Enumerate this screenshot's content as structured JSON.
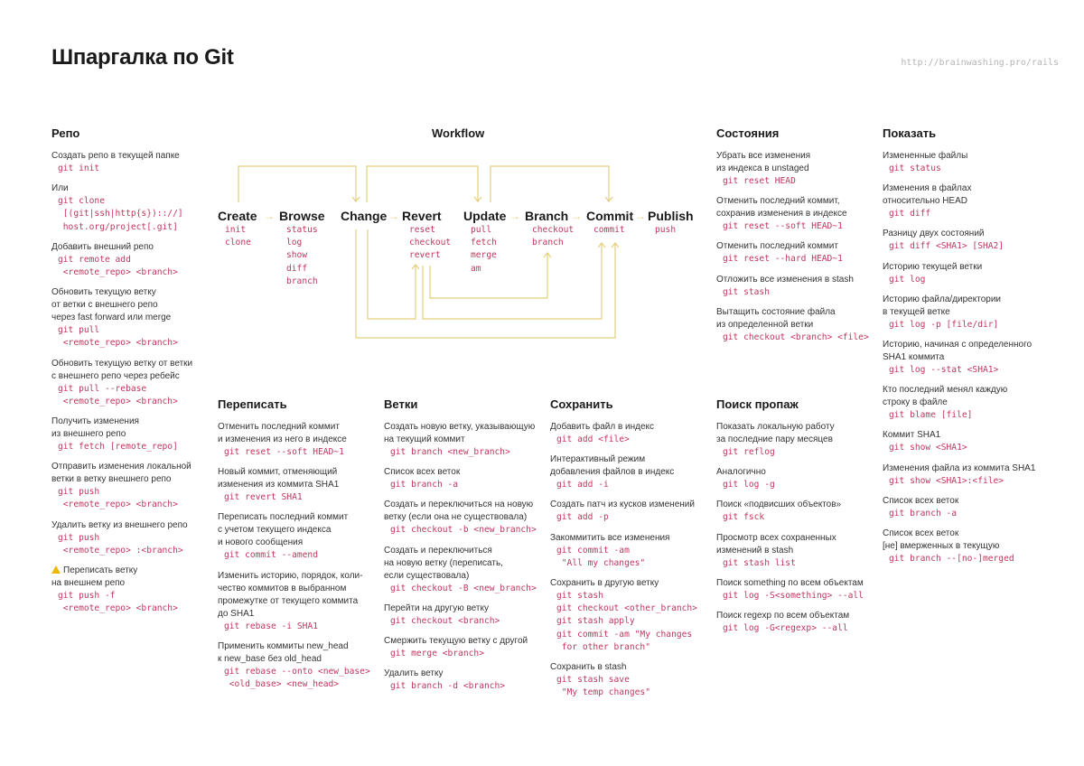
{
  "header": {
    "title": "Шпаргалка по Git",
    "url": "http://brainwashing.pro/rails"
  },
  "workflow": {
    "title": "Workflow",
    "arrow_color": "#e3cf7b",
    "stages": [
      {
        "name": "Create",
        "cmds": [
          "init",
          "clone"
        ]
      },
      {
        "name": "Browse",
        "cmds": [
          "status",
          "log",
          "show",
          "diff",
          "branch"
        ]
      },
      {
        "name": "Change",
        "cmds": []
      },
      {
        "name": "Revert",
        "cmds": [
          "reset",
          "checkout",
          "revert"
        ]
      },
      {
        "name": "Update",
        "cmds": [
          "pull",
          "fetch",
          "merge",
          "am"
        ]
      },
      {
        "name": "Branch",
        "cmds": [
          "checkout",
          "branch"
        ]
      },
      {
        "name": "Commit",
        "cmds": [
          "commit"
        ]
      },
      {
        "name": "Publish",
        "cmds": [
          "push"
        ]
      }
    ],
    "arrow_glyph": "→"
  },
  "sections": {
    "repo": {
      "title": "Репо",
      "entries": [
        {
          "desc": "Создать репо в текущей папке",
          "code": "git init"
        },
        {
          "desc": "Или",
          "code": "git clone\n [(git|ssh|http{s}):://]\n host.org/project[.git]"
        },
        {
          "desc": "Добавить внешний репо",
          "code": "git remote add\n <remote_repo> <branch>"
        },
        {
          "desc": "Обновить текущую ветку\nот ветки с внешнего репо\nчерез fast forward или merge",
          "code": "git pull\n <remote_repo> <branch>"
        },
        {
          "desc": "Обновить текущую ветку от ветки\nс внешнего репо через ребейс",
          "code": "git pull --rebase\n <remote_repo> <branch>"
        },
        {
          "desc": "Получить изменения\nиз внешнего репо",
          "code": "git fetch [remote_repo]"
        },
        {
          "desc": "Отправить изменения локальной\nветки в ветку внешнего репо",
          "code": "git push\n <remote_repo> <branch>"
        },
        {
          "desc": "Удалить ветку из внешнего репо",
          "code": "git push\n <remote_repo> :<branch>"
        },
        {
          "desc": "Переписать ветку\nна внешнем репо",
          "code": "git push -f\n <remote_repo> <branch>",
          "warning": true
        }
      ]
    },
    "states": {
      "title": "Состояния",
      "entries": [
        {
          "desc": "Убрать все изменения\nиз индекса в unstaged",
          "code": "git reset HEAD"
        },
        {
          "desc": "Отменить последний коммит,\nсохранив изменения в индексе",
          "code": "git reset --soft HEAD~1"
        },
        {
          "desc": "Отменить последний коммит",
          "code": "git reset --hard HEAD~1"
        },
        {
          "desc": "Отложить все изменения в stash",
          "code": "git stash"
        },
        {
          "desc": "Вытащить состояние файла\nиз определенной ветки",
          "code": "git checkout <branch> <file>"
        }
      ]
    },
    "show": {
      "title": "Показать",
      "entries": [
        {
          "desc": "Измененные файлы",
          "code": "git status"
        },
        {
          "desc": "Изменения в файлах\nотносительно HEAD",
          "code": "git diff"
        },
        {
          "desc": "Разницу двух состояний",
          "code": "git diff <SHA1> [SHA2]"
        },
        {
          "desc": "Историю текущей ветки",
          "code": "git log"
        },
        {
          "desc": "Историю файла/директории\nв текущей ветке",
          "code": "git log -p [file/dir]"
        },
        {
          "desc": "Историю, начиная с определенного\nSHA1 коммита",
          "code": "git log --stat <SHA1>"
        },
        {
          "desc": "Кто последний менял каждую\nстроку в файле",
          "code": "git blame [file]"
        },
        {
          "desc": "Коммит SHA1",
          "code": "git show <SHA1>"
        },
        {
          "desc": "Изменения файла из коммита SHA1",
          "code": "git show <SHA1>:<file>"
        },
        {
          "desc": "Список всех веток",
          "code": "git branch -a"
        },
        {
          "desc": "Список всех веток\n[не] вмерженных в текущую",
          "code": "git branch --[no-]merged"
        }
      ]
    },
    "rewrite": {
      "title": "Переписать",
      "entries": [
        {
          "desc": "Отменить последний коммит\nи изменения из него в индексе",
          "code": "git reset --soft HEAD~1"
        },
        {
          "desc": "Новый коммит, отменяющий\nизменения из коммита SHA1",
          "code": "git revert SHA1"
        },
        {
          "desc": "Переписать последний коммит\nс учетом текущего индекса\nи нового сообщения",
          "code": "git commit --amend"
        },
        {
          "desc": "Изменить историю, порядок, коли-\nчество коммитов в выбранном\nпромежутке от текущего коммита\nдо SHA1",
          "code": "git rebase -i SHA1"
        },
        {
          "desc": "Применить коммиты new_head\nк new_base без old_head",
          "code": "git rebase --onto <new_base>\n <old_base> <new_head>"
        }
      ]
    },
    "branches": {
      "title": "Ветки",
      "entries": [
        {
          "desc": "Создать новую ветку, указывающую\nна текущий коммит",
          "code": "git branch <new_branch>"
        },
        {
          "desc": "Список всех веток",
          "code": "git branch -a"
        },
        {
          "desc": "Создать и переключиться на новую\nветку (если она не существовала)",
          "code": "git checkout -b <new_branch>"
        },
        {
          "desc": "Создать и переключиться\nна новую ветку (переписать,\nесли существовала)",
          "code": "git checkout -B <new_branch>"
        },
        {
          "desc": "Перейти на другую ветку",
          "code": "git checkout <branch>"
        },
        {
          "desc": "Смержить текущую ветку с другой",
          "code": "git merge <branch>"
        },
        {
          "desc": "Удалить ветку",
          "code": "git branch -d <branch>"
        }
      ]
    },
    "save": {
      "title": "Сохранить",
      "entries": [
        {
          "desc": "Добавить файл в индекс",
          "code": "git add <file>"
        },
        {
          "desc": "Интерактивный режим\nдобавления файлов в индекс",
          "code": "git add -i"
        },
        {
          "desc": "Создать патч из кусков изменений",
          "code": "git add -p"
        },
        {
          "desc": "Закоммитить все изменения",
          "code": "git commit -am\n \"All my changes\""
        },
        {
          "desc": "Сохранить в другую ветку",
          "code": "git stash\ngit checkout <other_branch>\ngit stash apply\ngit commit -am \"My changes\n for other branch\""
        },
        {
          "desc": "Сохранить в stash",
          "code": "git stash save\n \"My temp changes\""
        }
      ]
    },
    "lost": {
      "title": "Поиск пропаж",
      "entries": [
        {
          "desc": "Показать локальную работу\nза последние пару месяцев",
          "code": "git reflog"
        },
        {
          "desc": "Аналогично",
          "code": "git log -g"
        },
        {
          "desc": "Поиск «подвисших объектов»",
          "code": "git fsck"
        },
        {
          "desc": "Просмотр всех сохраненных\nизменений в stash",
          "code": "git stash list"
        },
        {
          "desc": "Поиск something по всем объектам",
          "code": "git log -S<something> --all"
        },
        {
          "desc": "Поиск regexp по всем объектам",
          "code": "git log -G<regexp> --all"
        }
      ]
    }
  }
}
